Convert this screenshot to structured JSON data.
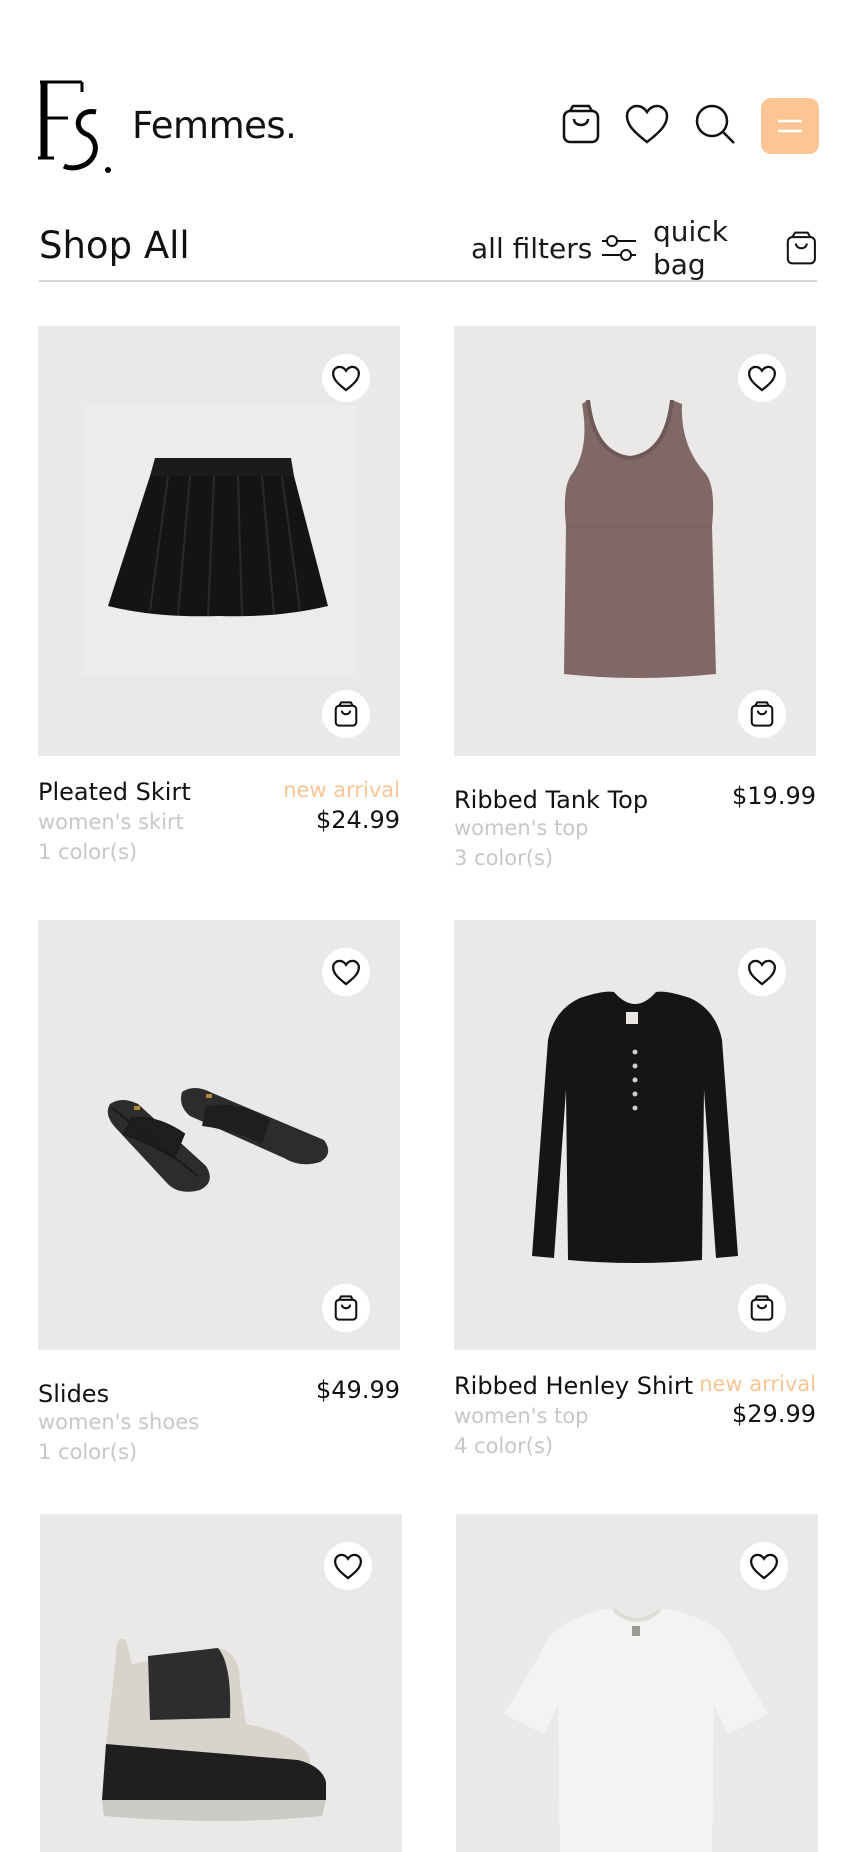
{
  "header": {
    "brand": "Femmes.",
    "logo_icon": "fs-monogram-logo",
    "icons": [
      "shopping-bag-icon",
      "heart-icon",
      "search-icon",
      "menu-icon"
    ],
    "menu_button_color": "#fdc594"
  },
  "shopbar": {
    "title": "Shop All",
    "filters_label": "all filters",
    "quickbag_label": "quick bag"
  },
  "colors": {
    "accent": "#fdc594",
    "muted_text": "#c7c7c7",
    "image_bg": "#ebe9e7"
  },
  "products": [
    {
      "name": "Pleated Skirt",
      "category": "women's skirt",
      "colors": "1 color(s)",
      "badge": "new arrival",
      "price": "$24.99"
    },
    {
      "name": "Ribbed Tank Top",
      "category": "women's top",
      "colors": "3 color(s)",
      "badge": "",
      "price": "$19.99"
    },
    {
      "name": "Slides",
      "category": "women's shoes",
      "colors": "1 color(s)",
      "badge": "",
      "price": "$49.99"
    },
    {
      "name": "Ribbed Henley Shirt",
      "category": "women's top",
      "colors": "4 color(s)",
      "badge": "new arrival",
      "price": "$29.99"
    },
    {
      "name": "",
      "category": "",
      "colors": "",
      "badge": "",
      "price": ""
    },
    {
      "name": "",
      "category": "",
      "colors": "",
      "badge": "",
      "price": ""
    }
  ]
}
